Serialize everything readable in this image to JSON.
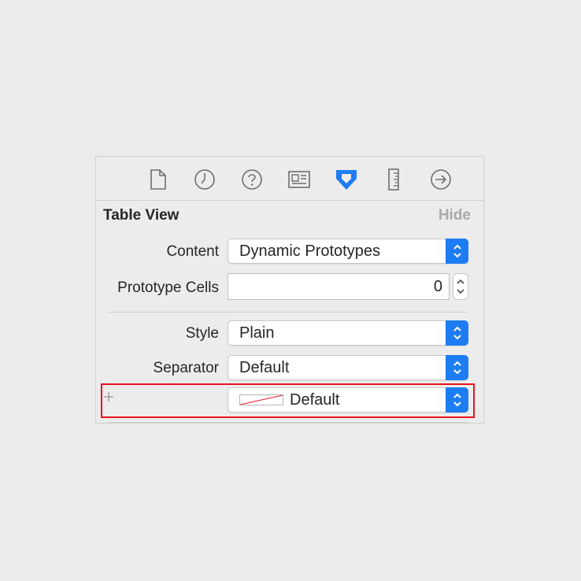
{
  "toolbar": {
    "tabs": [
      {
        "name": "file-inspector",
        "icon": "file-icon"
      },
      {
        "name": "history-inspector",
        "icon": "clock-icon"
      },
      {
        "name": "quick-help",
        "icon": "question-icon"
      },
      {
        "name": "identity-inspector",
        "icon": "identity-card-icon"
      },
      {
        "name": "attributes-inspector",
        "icon": "attributes-icon",
        "active": true
      },
      {
        "name": "size-inspector",
        "icon": "ruler-icon"
      },
      {
        "name": "connections-inspector",
        "icon": "arrow-circle-icon"
      }
    ]
  },
  "section": {
    "title": "Table View",
    "hide_label": "Hide"
  },
  "fields": {
    "content": {
      "label": "Content",
      "value": "Dynamic Prototypes"
    },
    "prototype_cells": {
      "label": "Prototype Cells",
      "value": "0"
    },
    "style": {
      "label": "Style",
      "value": "Plain"
    },
    "separator": {
      "label": "Separator",
      "value": "Default"
    },
    "separator_color": {
      "add_label": "+",
      "value": "Default"
    }
  },
  "colors": {
    "accent": "#1d7cf2",
    "highlight": "#e8131f",
    "muted": "#a9a9a9"
  }
}
